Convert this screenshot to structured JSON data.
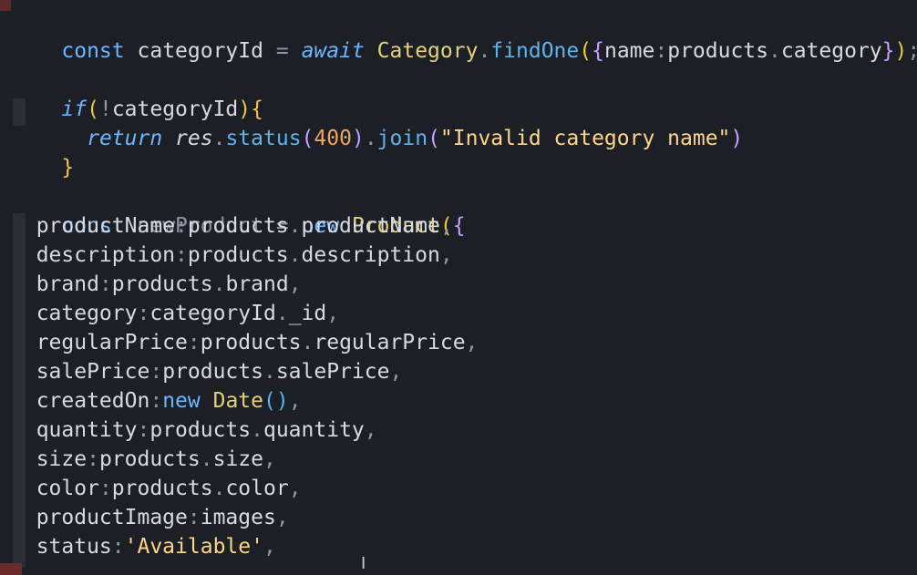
{
  "editor": {
    "lines": [
      "const categoryId = await Category.findOne({name:products.category});",
      "",
      "if(!categoryId){",
      "  return res.status(400).join(\"Invalid category name\")",
      "}",
      "",
      "const newProduct = new Product({",
      "  productName:products.productName,",
      "  description:products.description,",
      "  brand:products.brand,",
      "  category:categoryId._id,",
      "  regularPrice:products.regularPrice,",
      "  salePrice:products.salePrice,",
      "  createdOn:new Date(),",
      "  quantity:products.quantity,",
      "  size:products.size,",
      "  color:products.color,",
      "  productImage:images,",
      "  status:'Available',"
    ]
  },
  "colors": {
    "background": "#1c1f26",
    "text": "#d7dae0",
    "keyword": "#6bb6ff",
    "class_name": "#e6d17a",
    "function": "#5fb3e8",
    "string": "#ffd58a",
    "number": "#f0a35e",
    "brace": "#f4c542",
    "indent_guide": "#2a2e36"
  },
  "icons": {
    "cursor": "i-beam-cursor-icon"
  }
}
